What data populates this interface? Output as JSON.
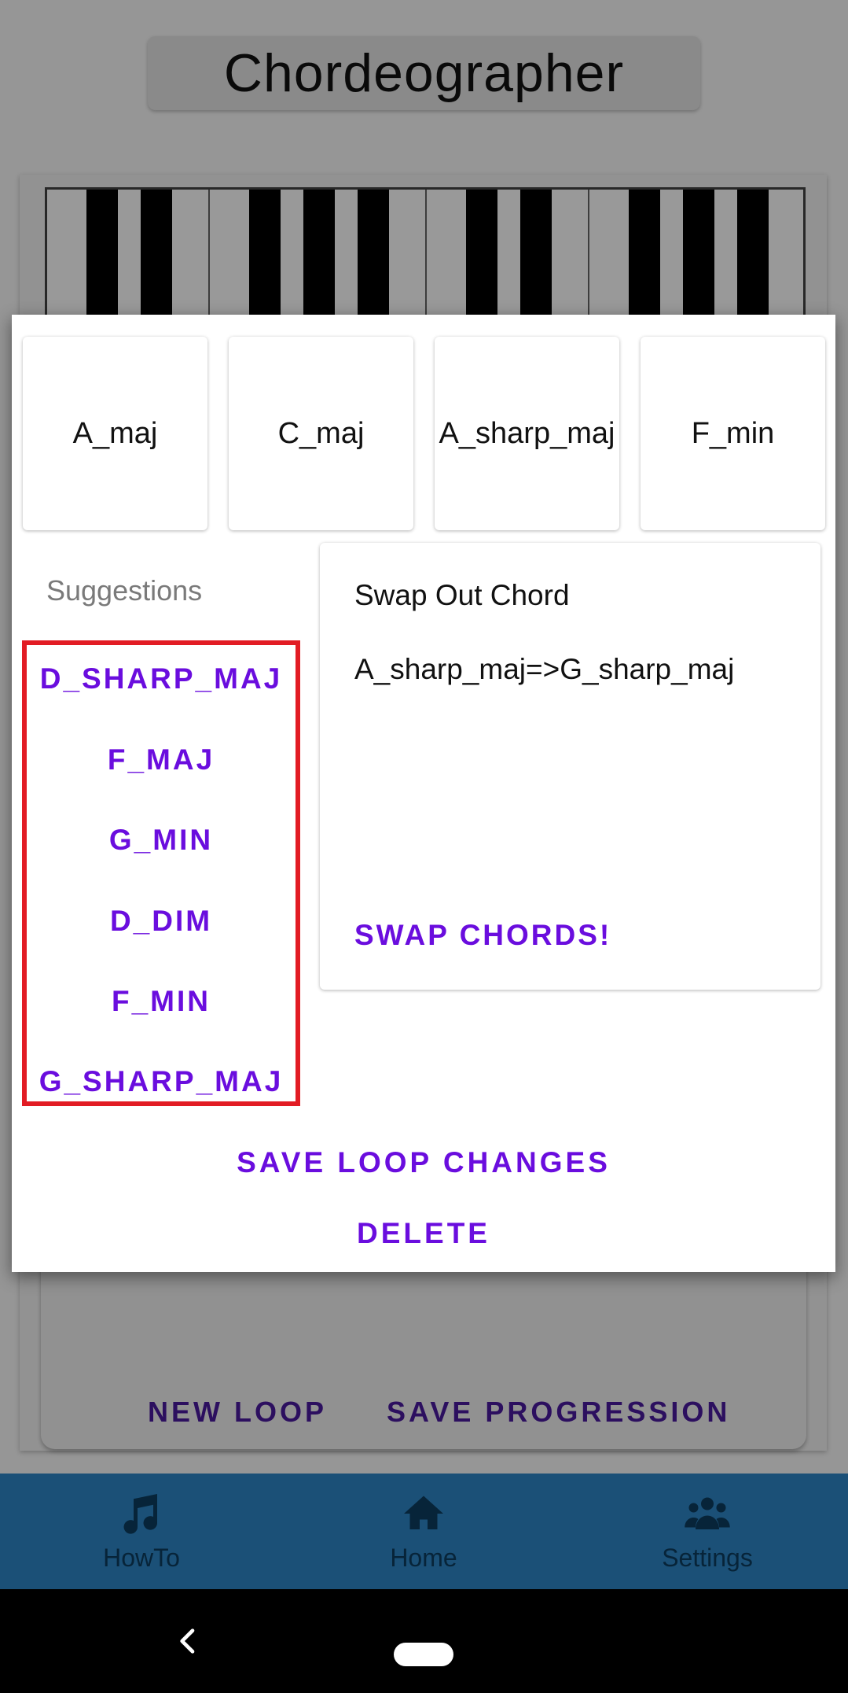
{
  "app": {
    "title": "Chordeographer"
  },
  "card_actions": {
    "new_loop": "NEW LOOP",
    "save_progression": "SAVE PROGRESSION"
  },
  "nav": {
    "items": [
      {
        "label": "HowTo",
        "icon": "music-note-icon"
      },
      {
        "label": "Home",
        "icon": "home-icon"
      },
      {
        "label": "Settings",
        "icon": "users-icon"
      }
    ]
  },
  "dialog": {
    "chords": [
      "A_maj",
      "C_maj",
      "A_sharp_maj",
      "F_min"
    ],
    "suggestions_title": "Suggestions",
    "suggestions": [
      "D_SHARP_MAJ",
      "F_MAJ",
      "G_MIN",
      "D_DIM",
      "F_MIN",
      "G_SHARP_MAJ"
    ],
    "swap": {
      "title": "Swap Out Chord",
      "detail": "A_sharp_maj=>G_sharp_maj",
      "button": "SWAP CHORDS!"
    },
    "save_label": "SAVE LOOP CHANGES",
    "delete_label": "DELETE"
  },
  "colors": {
    "accent": "#6a0dde",
    "highlight": "#e21c24",
    "nav_bg": "#2d86c6"
  }
}
